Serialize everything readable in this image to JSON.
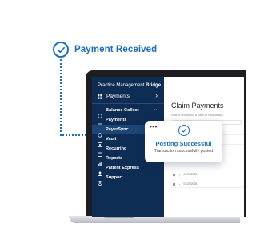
{
  "callout": {
    "text": "Payment Received",
    "icon": "check-circle-icon"
  },
  "app": {
    "brand_regular": "Practice Management",
    "brand_bold": "Bridge"
  },
  "sidebar": {
    "top_item": {
      "label": "Payments",
      "icon": "grid-icon"
    },
    "items": [
      {
        "label": "Balance Collect",
        "icon": "coin-icon",
        "has_chevron": true
      },
      {
        "label": "Payments",
        "icon": "card-icon"
      },
      {
        "label": "PayerSync",
        "icon": "sync-icon",
        "active": true
      },
      {
        "label": "Vault",
        "icon": "vault-icon"
      },
      {
        "label": "Recurring",
        "icon": "recurring-icon"
      },
      {
        "label": "Reports",
        "icon": "reports-icon"
      },
      {
        "label": "Patient Express",
        "icon": "patient-icon"
      },
      {
        "label": "Support",
        "icon": "support-icon"
      }
    ]
  },
  "main": {
    "title": "Claim Payments",
    "subtitle": "Search and select a claim to view details.",
    "rows": [
      {
        "date": ""
      },
      {
        "date": ""
      },
      {
        "date": "01/29/2025"
      },
      {
        "date": "01/25/2025"
      }
    ]
  },
  "popup": {
    "menu": "•••",
    "title": "Posting Successful",
    "message": "Transaction successfully posted"
  },
  "colors": {
    "brand_blue": "#1f6fb5",
    "sidebar": "#0d2d55",
    "sidebar_active": "#1c4675"
  }
}
